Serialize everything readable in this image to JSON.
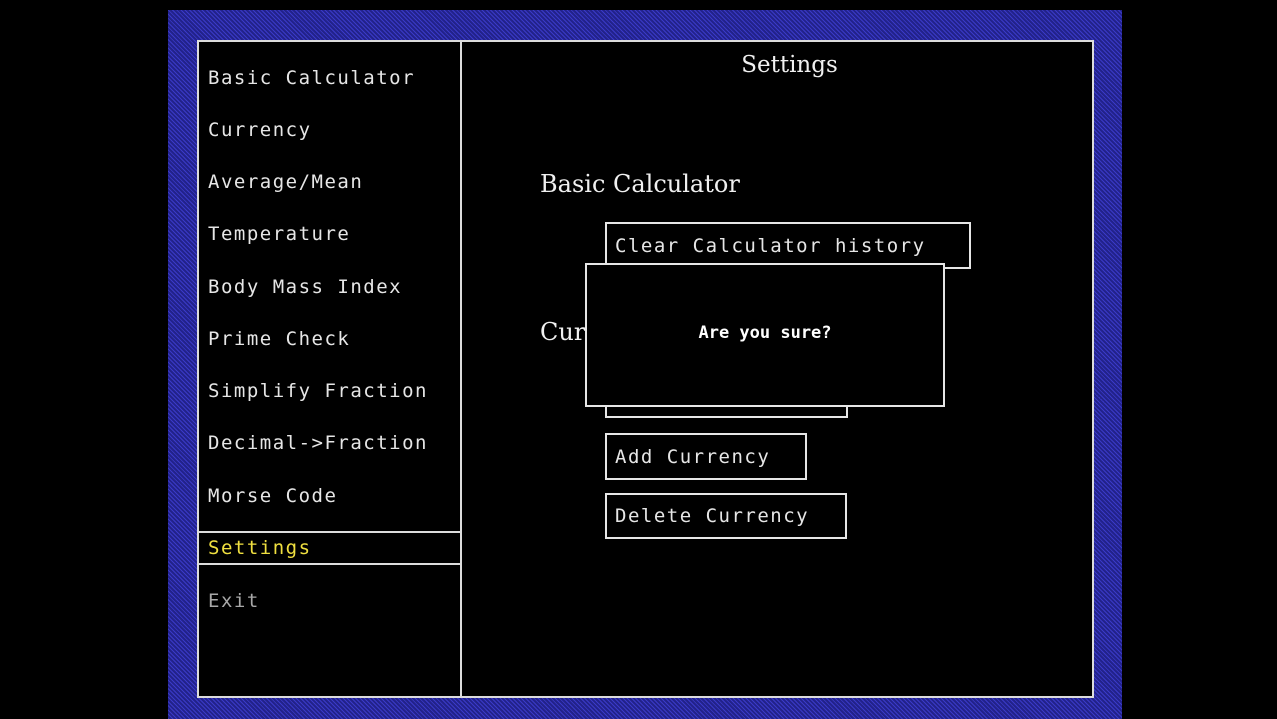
{
  "sidebar": {
    "items": [
      {
        "label": "Basic Calculator"
      },
      {
        "label": "Currency"
      },
      {
        "label": "Average/Mean"
      },
      {
        "label": "Temperature"
      },
      {
        "label": "Body Mass Index"
      },
      {
        "label": "Prime Check"
      },
      {
        "label": "Simplify Fraction"
      },
      {
        "label": "Decimal->Fraction"
      },
      {
        "label": "Morse Code"
      },
      {
        "label": "Settings",
        "selected": true
      },
      {
        "label": "Exit"
      }
    ]
  },
  "main": {
    "title": "Settings",
    "sections": {
      "basic": {
        "heading": "Basic Calculator",
        "clear_history_label": "Clear Calculator history"
      },
      "currency": {
        "heading_visible": "Cur",
        "add_label": "Add Currency",
        "delete_label": "Delete Currency"
      }
    }
  },
  "dialog": {
    "message": "Are you sure?"
  },
  "colors": {
    "background": "#000000",
    "border": "#dcdcdc",
    "text": "#e6e6e6",
    "selected_text": "#f0e040",
    "screen_frame": "#2a2a9a"
  }
}
